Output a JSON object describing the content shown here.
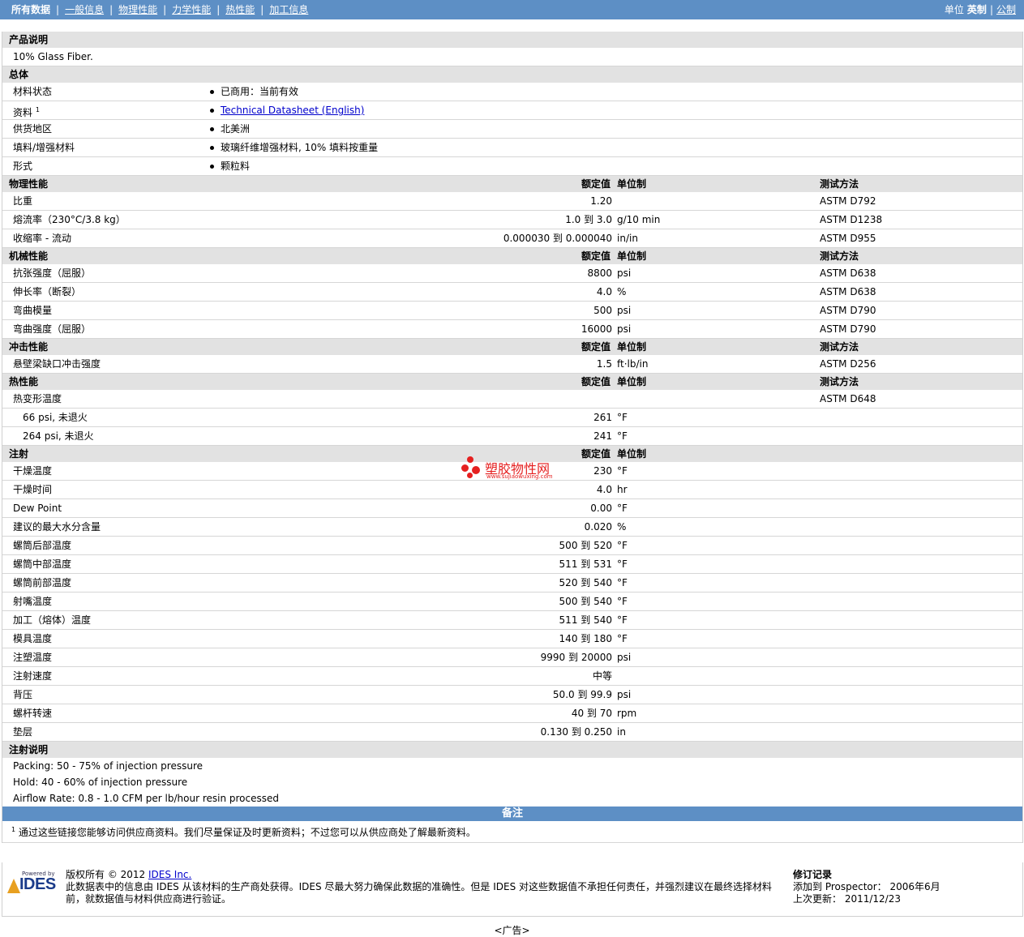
{
  "nav": {
    "items": [
      "所有数据",
      "一般信息",
      "物理性能",
      "力学性能",
      "热性能",
      "加工信息"
    ],
    "units_label": "单位",
    "unit_english": "英制",
    "unit_metric": "公制"
  },
  "product": {
    "title": "产品说明",
    "description": "10% Glass Fiber."
  },
  "general": {
    "title": "总体",
    "rows": [
      {
        "name": "材料状态",
        "value": "已商用：当前有效"
      },
      {
        "name": "资料",
        "sup": "1",
        "value": "Technical Datasheet (English)"
      },
      {
        "name": "供货地区",
        "value": "北美洲"
      },
      {
        "name": "填料/增强材料",
        "value": "玻璃纤维增强材料, 10% 填料按重量"
      },
      {
        "name": "形式",
        "value": "颗粒料"
      }
    ]
  },
  "headers": {
    "value": "额定值",
    "unit": "单位制",
    "method": "测试方法"
  },
  "physical": {
    "title": "物理性能",
    "rows": [
      {
        "name": "比重",
        "value": "1.20",
        "unit": "",
        "method": "ASTM D792"
      },
      {
        "name": "熔流率（230°C/3.8 kg）",
        "value": "1.0 到  3.0",
        "unit": "g/10 min",
        "method": "ASTM D1238"
      },
      {
        "name": "收缩率 - 流动",
        "value": "0.000030 到  0.000040",
        "unit": "in/in",
        "method": "ASTM D955"
      }
    ]
  },
  "mechanical": {
    "title": "机械性能",
    "rows": [
      {
        "name": "抗张强度（屈服）",
        "value": "8800",
        "unit": "psi",
        "method": "ASTM D638"
      },
      {
        "name": "伸长率（断裂）",
        "value": "4.0",
        "unit": "%",
        "method": "ASTM D638"
      },
      {
        "name": "弯曲模量",
        "value": "500",
        "unit": "psi",
        "method": "ASTM D790"
      },
      {
        "name": "弯曲强度（屈服）",
        "value": "16000",
        "unit": "psi",
        "method": "ASTM D790"
      }
    ]
  },
  "impact": {
    "title": "冲击性能",
    "rows": [
      {
        "name": "悬壁梁缺口冲击强度",
        "value": "1.5",
        "unit": "ft·lb/in",
        "method": "ASTM D256"
      }
    ]
  },
  "thermal": {
    "title": "热性能",
    "rows": [
      {
        "name": "热变形温度",
        "value": "",
        "unit": "",
        "method": "ASTM D648"
      },
      {
        "name": "66 psi, 未退火",
        "value": "261",
        "unit": "°F",
        "method": "",
        "indent": true
      },
      {
        "name": "264 psi, 未退火",
        "value": "241",
        "unit": "°F",
        "method": "",
        "indent": true
      }
    ]
  },
  "injection": {
    "title": "注射",
    "rows": [
      {
        "name": "干燥温度",
        "value": "230",
        "unit": "°F"
      },
      {
        "name": "干燥时间",
        "value": "4.0",
        "unit": "hr"
      },
      {
        "name": "Dew Point",
        "value": "0.00",
        "unit": "°F"
      },
      {
        "name": "建议的最大水分含量",
        "value": "0.020",
        "unit": "%"
      },
      {
        "name": "螺筒后部温度",
        "value": "500 到  520",
        "unit": "°F"
      },
      {
        "name": "螺筒中部温度",
        "value": "511 到  531",
        "unit": "°F"
      },
      {
        "name": "螺筒前部温度",
        "value": "520 到  540",
        "unit": "°F"
      },
      {
        "name": "射嘴温度",
        "value": "500 到  540",
        "unit": "°F"
      },
      {
        "name": "加工（熔体）温度",
        "value": "511 到  540",
        "unit": "°F"
      },
      {
        "name": "模具温度",
        "value": "140 到  180",
        "unit": "°F"
      },
      {
        "name": "注塑温度",
        "value": "9990 到  20000",
        "unit": "psi"
      },
      {
        "name": "注射速度",
        "value": "中等",
        "unit": ""
      },
      {
        "name": "背压",
        "value": "50.0 到  99.9",
        "unit": "psi"
      },
      {
        "name": "螺杆转速",
        "value": "40 到  70",
        "unit": "rpm"
      },
      {
        "name": "垫层",
        "value": "0.130 到  0.250",
        "unit": "in"
      }
    ]
  },
  "injection_notes": {
    "title": "注射说明",
    "lines": [
      "Packing: 50 - 75% of injection pressure",
      "Hold: 40 - 60% of injection pressure",
      "Airflow Rate: 0.8 - 1.0 CFM per lb/hour resin processed"
    ]
  },
  "remarks": {
    "title": "备注",
    "sup": "1",
    "text": "通过这些链接您能够访问供应商资料。我们尽量保证及时更新资料；不过您可以从供应商处了解最新资料。"
  },
  "footer": {
    "logo_powered": "Powered by",
    "logo_text": "IDES",
    "copyright_prefix": "版权所有  © 2012 ",
    "copyright_link": "IDES Inc.",
    "disclaimer": "此数据表中的信息由  IDES 从该材料的生产商处获得。IDES 尽最大努力确保此数据的准确性。但是  IDES 对这些数据值不承担任何责任，并强烈建议在最终选择材料前，就数据值与材料供应商进行验证。",
    "revision_title": "修订记录",
    "added": "添加到  Prospector：  2006年6月",
    "updated": "上次更新：   2011/12/23"
  },
  "ad": "<广告>",
  "watermark": {
    "cn": "塑胶物性网",
    "url": "www.sujiaowuxing.com"
  }
}
